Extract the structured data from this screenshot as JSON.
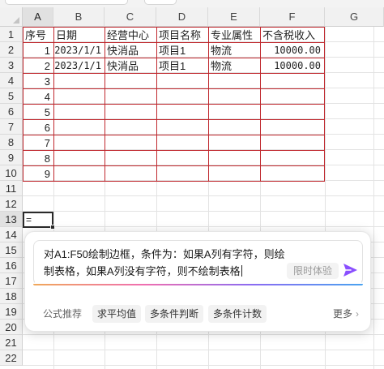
{
  "columns": [
    "A",
    "B",
    "C",
    "D",
    "E",
    "F",
    "G"
  ],
  "rows": [
    "1",
    "2",
    "3",
    "4",
    "5",
    "6",
    "7",
    "8",
    "9",
    "10",
    "11",
    "12",
    "13",
    "14",
    "15",
    "16",
    "17",
    "18",
    "19",
    "20",
    "21",
    "22"
  ],
  "table": {
    "headers": [
      "序号",
      "日期",
      "经营中心",
      "项目名称",
      "专业属性",
      "不含税收入"
    ],
    "rows": [
      [
        "1",
        "2023/1/1",
        "快消品",
        "项目1",
        "物流",
        "10000.00"
      ],
      [
        "2",
        "2023/1/1",
        "快消品",
        "项目1",
        "物流",
        "10000.00"
      ],
      [
        "3",
        "",
        "",
        "",
        "",
        ""
      ],
      [
        "4",
        "",
        "",
        "",
        "",
        ""
      ],
      [
        "5",
        "",
        "",
        "",
        "",
        ""
      ],
      [
        "6",
        "",
        "",
        "",
        "",
        ""
      ],
      [
        "7",
        "",
        "",
        "",
        "",
        ""
      ],
      [
        "8",
        "",
        "",
        "",
        "",
        ""
      ],
      [
        "9",
        "",
        "",
        "",
        "",
        ""
      ]
    ]
  },
  "active_cell": {
    "ref": "A13",
    "value": "="
  },
  "ai_assistant": {
    "prompt_text": "对A1:F50绘制边框，条件为：如果A列有字符，则绘制表格，如果A列没有字符，则不绘制表格",
    "trial_badge": "限时体验",
    "suggestions_label": "公式推荐",
    "suggestions": [
      "求平均值",
      "多条件判断",
      "多条件计数"
    ],
    "more_label": "更多",
    "send_icon": "send-arrow-icon",
    "accent_color": "#8a4fff"
  }
}
